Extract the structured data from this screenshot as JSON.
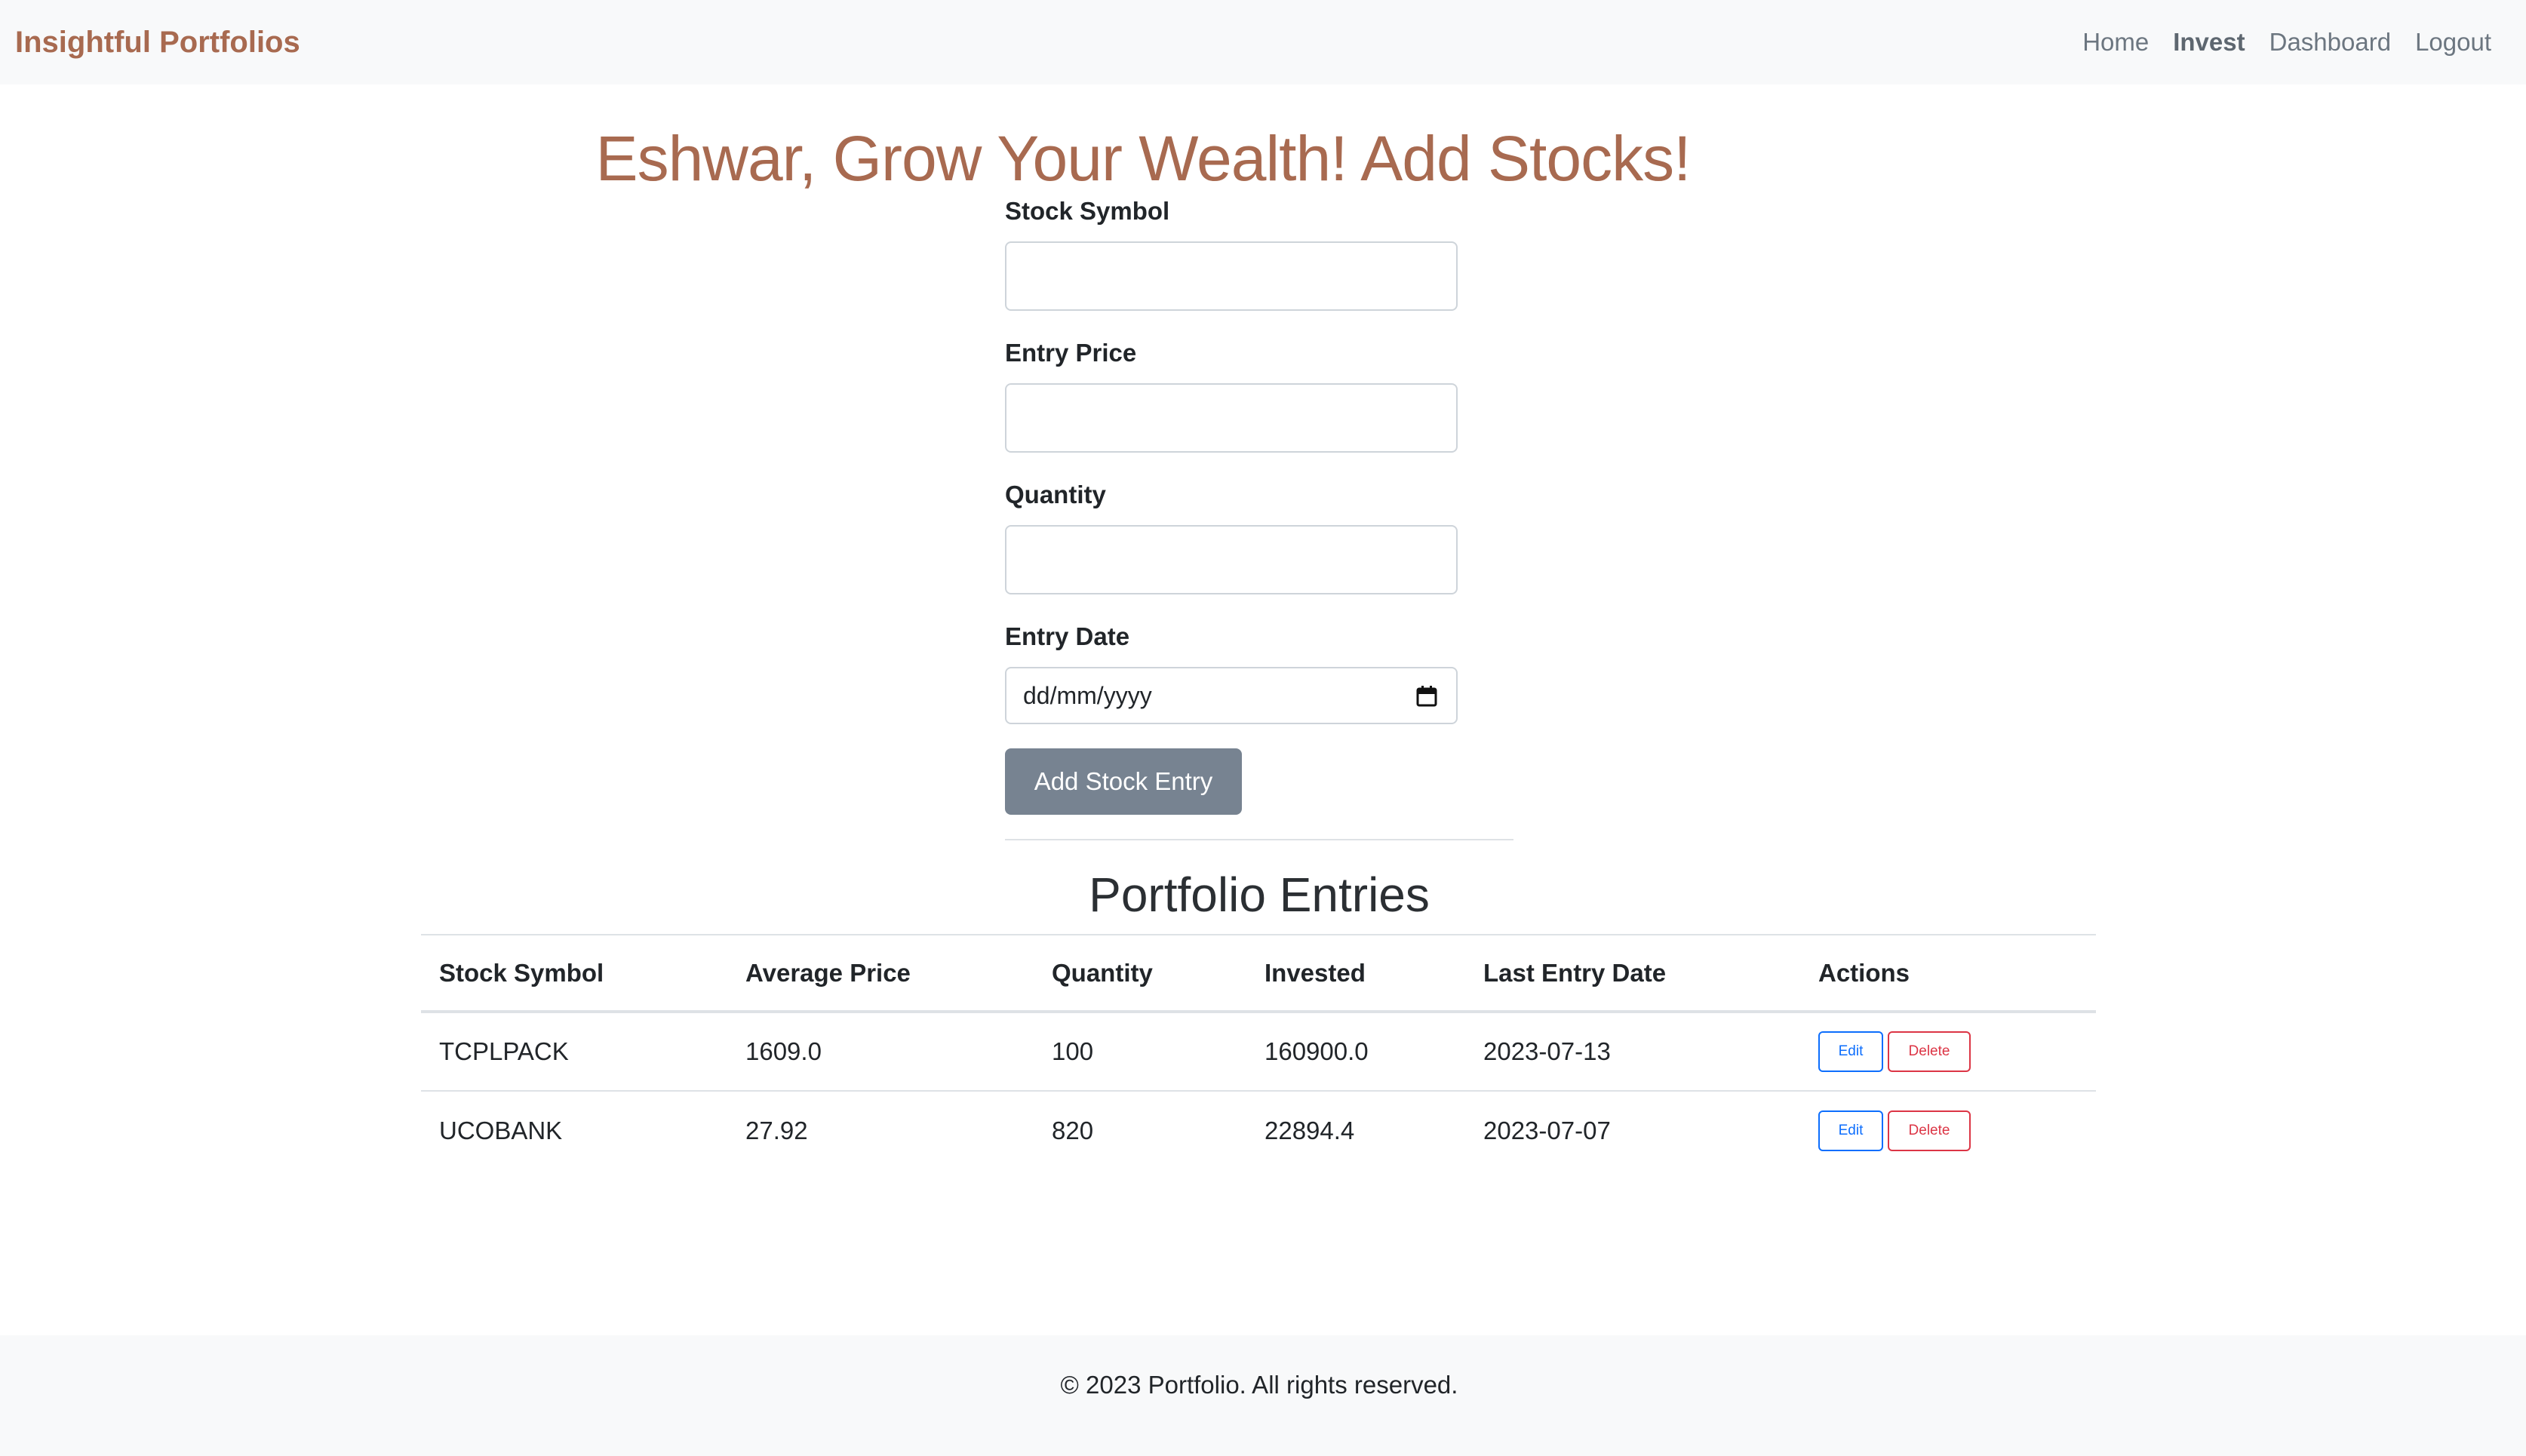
{
  "navbar": {
    "brand": "Insightful Portfolios",
    "links": [
      {
        "label": "Home",
        "active": false
      },
      {
        "label": "Invest",
        "active": true
      },
      {
        "label": "Dashboard",
        "active": false
      },
      {
        "label": "Logout",
        "active": false
      }
    ]
  },
  "hero": {
    "title": "Eshwar, Grow Your Wealth! Add Stocks!"
  },
  "form": {
    "stock_symbol": {
      "label": "Stock Symbol",
      "value": ""
    },
    "entry_price": {
      "label": "Entry Price",
      "value": ""
    },
    "quantity": {
      "label": "Quantity",
      "value": ""
    },
    "entry_date": {
      "label": "Entry Date",
      "placeholder": "dd/mm/yyyy",
      "icon": "calendar-icon"
    },
    "submit_label": "Add Stock Entry"
  },
  "portfolio": {
    "title": "Portfolio Entries",
    "columns": [
      "Stock Symbol",
      "Average Price",
      "Quantity",
      "Invested",
      "Last Entry Date",
      "Actions"
    ],
    "rows": [
      {
        "symbol": "TCPLPACK",
        "avg_price": "1609.0",
        "quantity": "100",
        "invested": "160900.0",
        "last_entry": "2023-07-13",
        "edit_label": "Edit",
        "delete_label": "Delete"
      },
      {
        "symbol": "UCOBANK",
        "avg_price": "27.92",
        "quantity": "820",
        "invested": "22894.4",
        "last_entry": "2023-07-07",
        "edit_label": "Edit",
        "delete_label": "Delete"
      }
    ]
  },
  "footer": {
    "text": "© 2023 Portfolio. All rights reserved."
  },
  "colors": {
    "brand": "#a86a50",
    "submit_button": "#778391",
    "edit_button": "#0d6efd",
    "delete_button": "#dc3545"
  }
}
